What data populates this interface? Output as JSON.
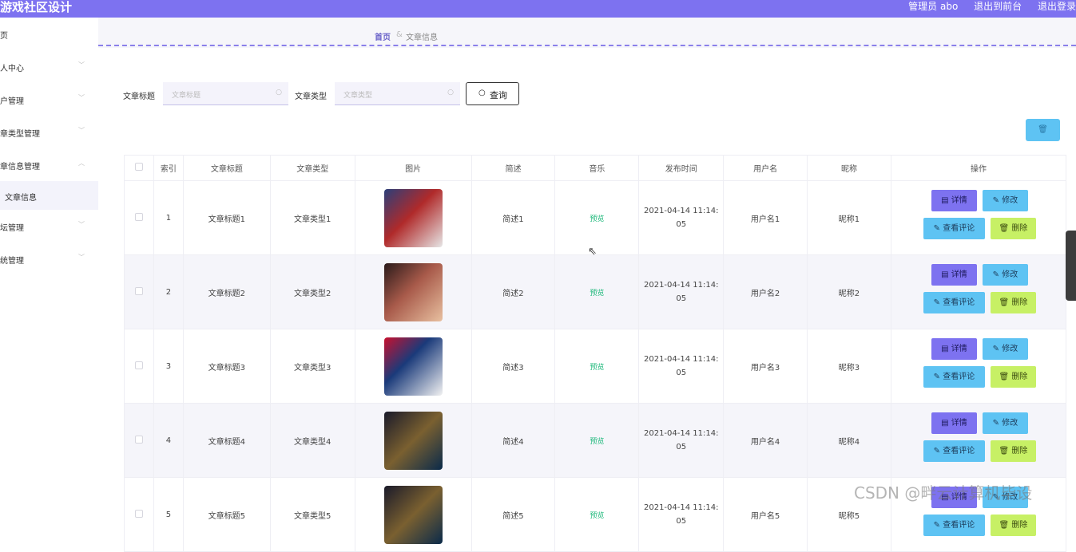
{
  "header": {
    "title": "游戏社区设计",
    "admin": "管理员 abo",
    "front": "退出到前台",
    "logout": "退出登录"
  },
  "sidebar": {
    "items": [
      {
        "label": "页"
      },
      {
        "label": "人中心"
      },
      {
        "label": "户管理"
      },
      {
        "label": "章类型管理"
      },
      {
        "label": "章信息管理"
      },
      {
        "label": "坛管理"
      },
      {
        "label": "统管理"
      }
    ],
    "subitem": "文章信息"
  },
  "breadcrumb": {
    "home": "首页",
    "sep": "&",
    "current": "文章信息"
  },
  "search": {
    "title_label": "文章标题",
    "title_placeholder": "文章标题",
    "type_label": "文章类型",
    "type_placeholder": "文章类型",
    "query_label": "查询"
  },
  "table": {
    "headers": [
      "索引",
      "文章标题",
      "文章类型",
      "图片",
      "简述",
      "音乐",
      "发布时间",
      "用户名",
      "昵称",
      "操作"
    ],
    "rows": [
      {
        "index": "1",
        "title": "文章标题1",
        "type": "文章类型1",
        "summary": "简述1",
        "music": "预览",
        "time_a": "2021-04-14 11:14:",
        "time_b": "05",
        "user": "用户名1",
        "nick": "昵称1"
      },
      {
        "index": "2",
        "title": "文章标题2",
        "type": "文章类型2",
        "summary": "简述2",
        "music": "预览",
        "time_a": "2021-04-14 11:14:",
        "time_b": "05",
        "user": "用户名2",
        "nick": "昵称2"
      },
      {
        "index": "3",
        "title": "文章标题3",
        "type": "文章类型3",
        "summary": "简述3",
        "music": "预览",
        "time_a": "2021-04-14 11:14:",
        "time_b": "05",
        "user": "用户名3",
        "nick": "昵称3"
      },
      {
        "index": "4",
        "title": "文章标题4",
        "type": "文章类型4",
        "summary": "简述4",
        "music": "预览",
        "time_a": "2021-04-14 11:14:",
        "time_b": "05",
        "user": "用户名4",
        "nick": "昵称4"
      },
      {
        "index": "5",
        "title": "文章标题5",
        "type": "文章类型5",
        "summary": "简述5",
        "music": "预览",
        "time_a": "2021-04-14 11:14:",
        "time_b": "05",
        "user": "用户名5",
        "nick": "昵称5"
      }
    ],
    "actions": {
      "detail": "详情",
      "edit": "修改",
      "comments": "查看评论",
      "delete": "删除"
    }
  },
  "watermark": "CSDN @畔云计算机毕设",
  "colors": {
    "accent": "#7d72f0",
    "info": "#5ec3f3",
    "danger": "#c7f065",
    "link": "#1db87a"
  }
}
